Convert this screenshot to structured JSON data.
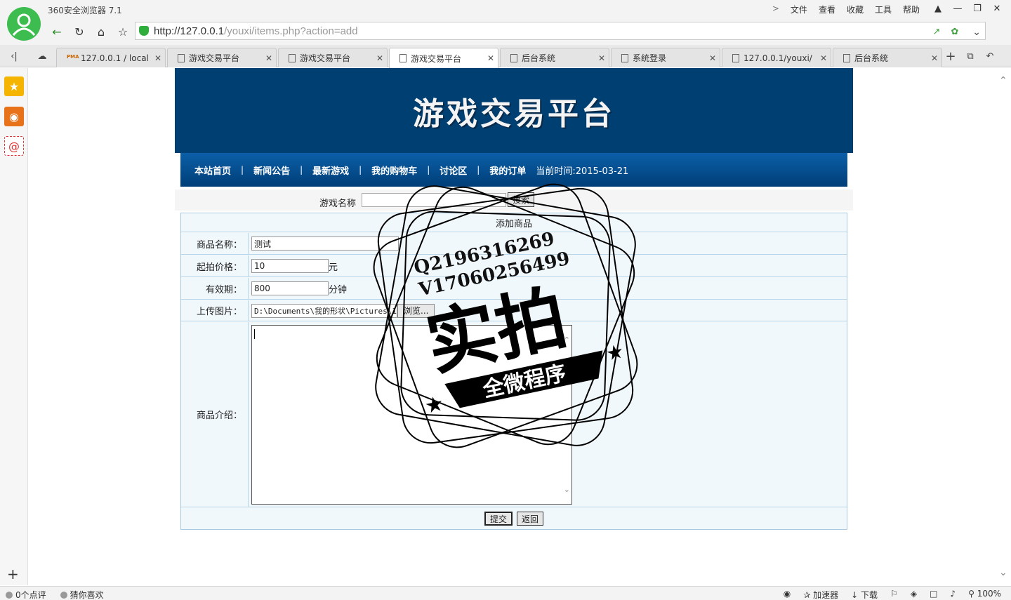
{
  "browser": {
    "app_title": "360安全浏览器 7.1",
    "menu": [
      "文件",
      "查看",
      "收藏",
      "工具",
      "帮助"
    ],
    "url_host": "http://127.0.0.1",
    "url_path": "/youxi/items.php?action=add"
  },
  "tabs": [
    {
      "label": "127.0.0.1 / local",
      "icon": "pma"
    },
    {
      "label": "游戏交易平台",
      "icon": "doc"
    },
    {
      "label": "游戏交易平台",
      "icon": "doc"
    },
    {
      "label": "游戏交易平台",
      "icon": "doc",
      "active": true
    },
    {
      "label": "后台系统",
      "icon": "doc"
    },
    {
      "label": "系统登录",
      "icon": "doc"
    },
    {
      "label": "127.0.0.1/youxi/",
      "icon": "doc"
    },
    {
      "label": "后台系统",
      "icon": "doc"
    }
  ],
  "site": {
    "title": "游戏交易平台",
    "nav": [
      "本站首页",
      "新闻公告",
      "最新游戏",
      "我的购物车",
      "讨论区",
      "我的订单"
    ],
    "current_time": "当前时间:2015-03-21"
  },
  "search": {
    "label": "游戏名称",
    "button": "搜索"
  },
  "form": {
    "caption": "添加商品",
    "name_label": "商品名称：",
    "name_value": "测试",
    "price_label": "起拍价格：",
    "price_value": "10",
    "price_unit": "元",
    "duration_label": "有效期：",
    "duration_value": "800",
    "duration_unit": "分钟",
    "image_label": "上传图片：",
    "image_path": "D:\\Documents\\我的形状\\Pictures\\1",
    "browse_button": "浏览...",
    "intro_label": "商品介绍：",
    "submit": "提交",
    "back": "返回"
  },
  "watermark": {
    "line1": "Q2196316269",
    "line2": "V17060256499",
    "main": "实拍",
    "ribbon": "全微程序"
  },
  "status": {
    "comments": "0个点评",
    "guess": "猜你喜欢",
    "accelerator": "加速器",
    "download": "下载",
    "zoom": "100%"
  },
  "colors": {
    "banner": "#003f72",
    "nav_top": "#0b5fa8",
    "form_bg": "#f1f8fc",
    "logo": "#3dbd4f"
  }
}
